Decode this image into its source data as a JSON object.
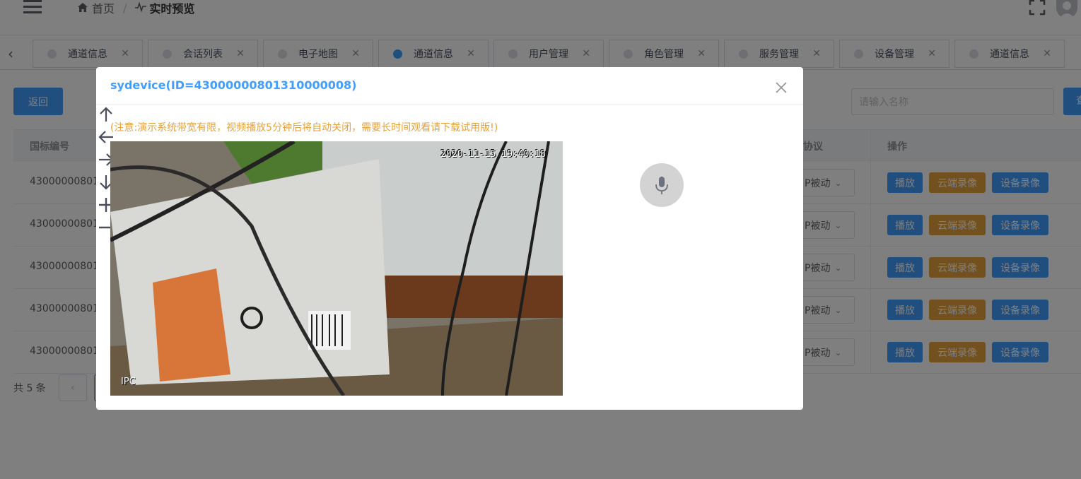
{
  "header": {
    "breadcrumb_home": "首页",
    "breadcrumb_separator": "/",
    "breadcrumb_current": "实时预览",
    "icons": [
      "hamburger-icon",
      "home-icon",
      "pulse-icon",
      "fullscreen-icon",
      "avatar-icon"
    ]
  },
  "tabs": [
    {
      "label": "通道信息",
      "active": false
    },
    {
      "label": "会话列表",
      "active": false
    },
    {
      "label": "电子地图",
      "active": false
    },
    {
      "label": "通道信息",
      "active": true
    },
    {
      "label": "用户管理",
      "active": false
    },
    {
      "label": "角色管理",
      "active": false
    },
    {
      "label": "服务管理",
      "active": false
    },
    {
      "label": "设备管理",
      "active": false
    },
    {
      "label": "通道信息",
      "active": false
    }
  ],
  "toolbar": {
    "back_label": "返回",
    "search_placeholder": "请输入名称",
    "search_button_label": "查"
  },
  "table": {
    "headers": {
      "col_id": "国标编号",
      "col_protocol": "协议",
      "col_actions": "操作"
    },
    "rows": [
      {
        "id": "43000000801",
        "protocol": "P被动"
      },
      {
        "id": "43000000801",
        "protocol": "P被动"
      },
      {
        "id": "43000000801",
        "protocol": "P被动"
      },
      {
        "id": "43000000801",
        "protocol": "P被动"
      },
      {
        "id": "43000000801",
        "protocol": "P被动"
      }
    ],
    "actions": {
      "play": "播放",
      "cloud": "云端录像",
      "device": "设备录像"
    }
  },
  "pagination": {
    "total_text": "共 5 条"
  },
  "dialog": {
    "title": "sydevice(ID=43000000801310000008)",
    "note": "(注意:演示系统带宽有限，视频播放5分钟后将自动关闭，需要长时间观看请下载试用版!)",
    "video": {
      "osd_time": "2020-11-15 19:40:18",
      "osd_name": "IPC"
    },
    "ptz_icons": [
      "arrow-up-icon",
      "arrow-left-icon",
      "microphone-icon",
      "arrow-right-icon",
      "arrow-down-icon",
      "zoom-in-icon",
      "zoom-out-icon"
    ]
  },
  "colors": {
    "primary": "#409eff",
    "warning": "#e6a23c",
    "mask": "rgba(0,0,0,0.5)"
  }
}
